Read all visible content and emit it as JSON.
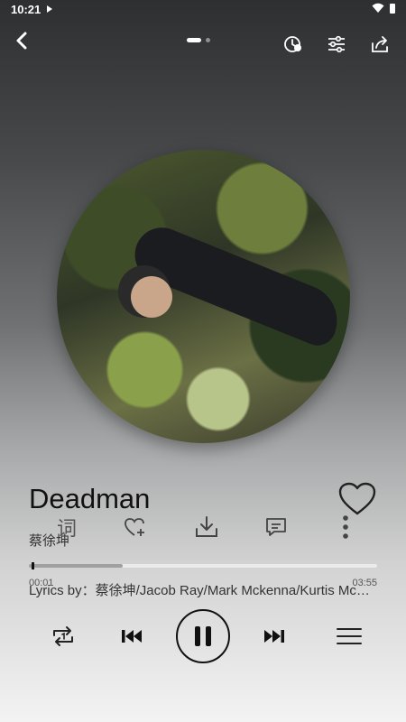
{
  "status_bar": {
    "time": "10:21"
  },
  "page_indicator": {
    "current": 1,
    "total": 2
  },
  "song": {
    "title": "Deadman",
    "artist": "蔡徐坤"
  },
  "actions": {
    "lyrics_icon_text": "词"
  },
  "progress": {
    "current_time": "00:01",
    "total_time": "03:55",
    "played_fraction": 0.008,
    "buffered_fraction": 0.27
  },
  "lyrics_credit": "Lyrics by：蔡徐坤/Jacob Ray/Mark Mckenna/Kurtis McKenzie",
  "icons": {
    "back": "chevron-left-icon",
    "timer": "sleep-timer-icon",
    "equalizer": "sliders-icon",
    "share": "share-icon",
    "like": "heart-icon",
    "favorite_add": "heart-plus-icon",
    "download": "download-icon",
    "comment": "comment-icon",
    "more": "more-vertical-icon",
    "repeat": "repeat-one-icon",
    "previous": "skip-previous-icon",
    "pause": "pause-icon",
    "next": "skip-next-icon",
    "playlist": "playlist-icon"
  }
}
